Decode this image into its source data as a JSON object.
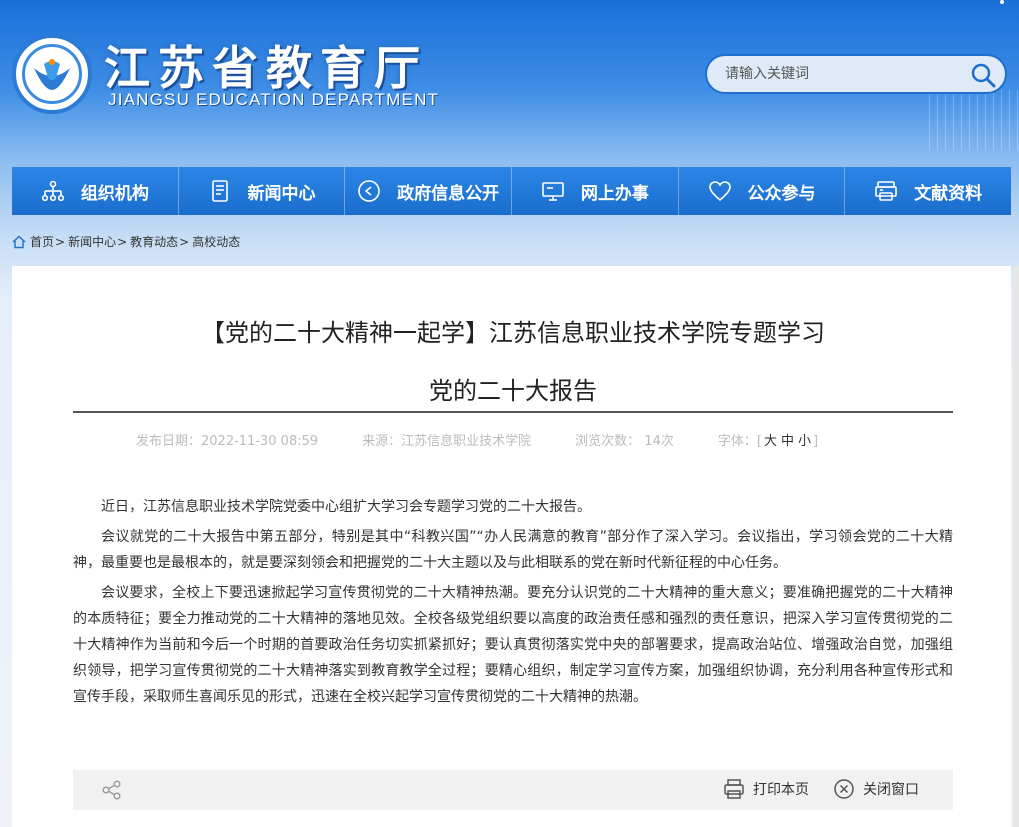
{
  "header": {
    "title": "江苏省教育厅",
    "subtitle": "JIANGSU EDUCATION DEPARTMENT",
    "search_placeholder": "请输入关键词"
  },
  "nav": {
    "items": [
      {
        "label": "组织机构",
        "icon": "org-chart-icon"
      },
      {
        "label": "新闻中心",
        "icon": "document-icon"
      },
      {
        "label": "政府信息公开",
        "icon": "circle-arrow-icon"
      },
      {
        "label": "网上办事",
        "icon": "monitor-icon"
      },
      {
        "label": "公众参与",
        "icon": "heart-icon"
      },
      {
        "label": "文献资料",
        "icon": "printer-stack-icon"
      }
    ]
  },
  "breadcrumb": {
    "items": [
      "首页",
      "新闻中心",
      "教育动态",
      "高校动态"
    ],
    "separator": ">"
  },
  "article": {
    "title_line1": "【党的二十大精神一起学】江苏信息职业技术学院专题学习",
    "title_line2": "党的二十大报告",
    "meta": {
      "date": "发布日期：2022-11-30 08:59",
      "source": "来源：江苏信息职业技术学院",
      "views": "浏览次数： 14次",
      "font_label": "字体：",
      "font_open": "[",
      "font_large": "大",
      "font_medium": "中",
      "font_small": "小",
      "font_close": "]"
    },
    "paragraphs": [
      "近日，江苏信息职业技术学院党委中心组扩大学习会专题学习党的二十大报告。",
      "会议就党的二十大报告中第五部分，特别是其中“科教兴国”“办人民满意的教育”部分作了深入学习。会议指出，学习领会党的二十大精神，最重要也是最根本的，就是要深刻领会和把握党的二十大主题以及与此相联系的党在新时代新征程的中心任务。",
      "会议要求，全校上下要迅速掀起学习宣传贯彻党的二十大精神热潮。要充分认识党的二十大精神的重大意义；要准确把握党的二十大精神的本质特征；要全力推动党的二十大精神的落地见效。全校各级党组织要以高度的政治责任感和强烈的责任意识，把深入学习宣传贯彻党的二十大精神作为当前和今后一个时期的首要政治任务切实抓紧抓好；要认真贯彻落实党中央的部署要求，提高政治站位、增强政治自觉，加强组织领导，把学习宣传贯彻党的二十大精神落实到教育教学全过程；要精心组织，制定学习宣传方案，加强组织协调，充分利用各种宣传形式和宣传手段，采取师生喜闻乐见的形式，迅速在全校兴起学习宣传贯彻党的二十大精神的热潮。"
    ]
  },
  "toolbar": {
    "print_label": "打印本页",
    "close_label": "关闭窗口"
  },
  "colors": {
    "nav_blue": "#1f78d8",
    "header_blue": "#1a6fd8"
  }
}
